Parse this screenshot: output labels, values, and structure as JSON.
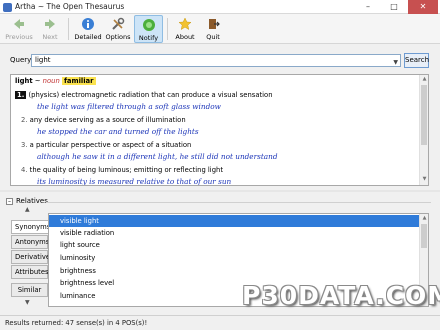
{
  "window": {
    "title": "Artha ~ The Open Thesaurus",
    "minimize": "–",
    "maximize": "□",
    "close": "✕"
  },
  "toolbar": {
    "previous": "Previous",
    "next": "Next",
    "detailed": "Detailed",
    "options": "Options",
    "notify": "Notify",
    "about": "About",
    "quit": "Quit"
  },
  "query": {
    "label": "Query",
    "value": "light",
    "search_label": "Search"
  },
  "results": {
    "headword": "light",
    "sep": "~",
    "pos": "noun",
    "synonym": "familiar",
    "senses": [
      {
        "num": "1.",
        "text": "(physics) electromagnetic radiation that can produce a visual sensation",
        "example": "the light was filtered through a soft glass window"
      },
      {
        "num": "2.",
        "text": "any device serving as a source of illumination",
        "example": "he stopped the car and turned off the lights"
      },
      {
        "num": "3.",
        "text": "a particular perspective or aspect of a situation",
        "example": "although he saw it in a different light, he still did not understand"
      },
      {
        "num": "4.",
        "text": "the quality of being luminous; emitting or reflecting light",
        "example": "its luminosity is measured relative to that of our sun"
      }
    ]
  },
  "relatives": {
    "title": "Relatives",
    "collapse": "⊟",
    "tabs": [
      "Synonyms",
      "Antonyms",
      "Derivatives",
      "Attributes",
      "Similar"
    ],
    "items": [
      "visible light",
      "visible radiation",
      "light source",
      "luminosity",
      "brightness",
      "brightness level",
      "luminance"
    ]
  },
  "status": {
    "text": "Results returned: 47 sense(s) in 4 POS(s)!"
  },
  "watermark": "P30DATA.COM",
  "colors": {
    "accent": "#2f7bd9",
    "example_text": "#1c35b8",
    "pos_text": "#c03030",
    "highlight": "#fbe34f",
    "close_button": "#c75050"
  }
}
